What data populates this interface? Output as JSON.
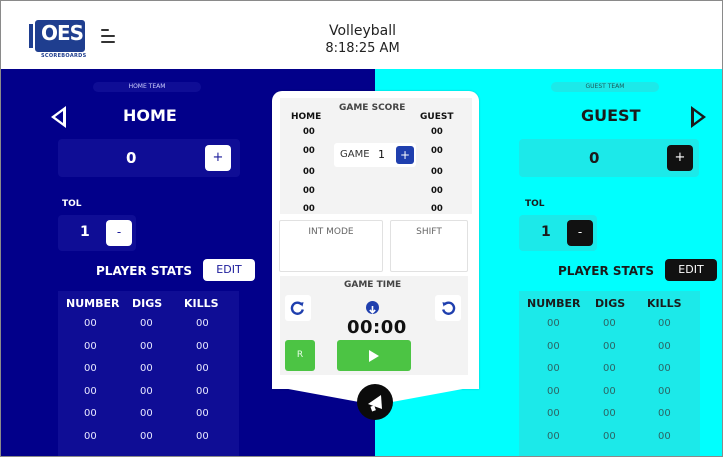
{
  "header": {
    "logo_text": "OES",
    "logo_sub": "SCOREBOARDS",
    "title": "Volleyball",
    "clock": "8:18:25 AM"
  },
  "home": {
    "pill": "HOME TEAM",
    "name": "HOME",
    "score": "0",
    "plus": "+",
    "tol_label": "TOL",
    "tol_value": "1",
    "minus": "-",
    "player_stats": "PLAYER STATS",
    "edit": "EDIT",
    "stats_headers": [
      "NUMBER",
      "DIGS",
      "KILLS"
    ],
    "stats_rows": [
      [
        "00",
        "00",
        "00"
      ],
      [
        "00",
        "00",
        "00"
      ],
      [
        "00",
        "00",
        "00"
      ],
      [
        "00",
        "00",
        "00"
      ],
      [
        "00",
        "00",
        "00"
      ],
      [
        "00",
        "00",
        "00"
      ]
    ]
  },
  "guest": {
    "pill": "GUEST TEAM",
    "name": "GUEST",
    "score": "0",
    "plus": "+",
    "tol_label": "TOL",
    "tol_value": "1",
    "minus": "-",
    "player_stats": "PLAYER STATS",
    "edit": "EDIT",
    "stats_headers": [
      "NUMBER",
      "DIGS",
      "KILLS"
    ],
    "stats_rows": [
      [
        "00",
        "00",
        "00"
      ],
      [
        "00",
        "00",
        "00"
      ],
      [
        "00",
        "00",
        "00"
      ],
      [
        "00",
        "00",
        "00"
      ],
      [
        "00",
        "00",
        "00"
      ],
      [
        "00",
        "00",
        "00"
      ]
    ]
  },
  "center": {
    "game_score_title": "GAME SCORE",
    "home_label": "HOME",
    "guest_label": "GUEST",
    "home_games": [
      "00",
      "00",
      "00",
      "00",
      "00"
    ],
    "guest_games": [
      "00",
      "00",
      "00",
      "00",
      "00"
    ],
    "game_label": "GAME",
    "game_number": "1",
    "game_plus": "+",
    "int_mode": "INT MODE",
    "shift": "SHIFT",
    "game_time_title": "GAME TIME",
    "time": "00:00",
    "r_label": "R"
  },
  "colors": {
    "home_bg": "#02008a",
    "guest_bg": "#00fffe",
    "accent_blue": "#1f3fae",
    "play_green": "#4cc444"
  },
  "icons": {
    "menu": "hamburger-icon",
    "home_arrow": "triangle-left-icon",
    "guest_arrow": "triangle-right-icon",
    "redo": "redo-icon",
    "undo": "undo-icon",
    "down": "arrow-down-circle-icon",
    "play": "play-icon",
    "horn": "horn-icon"
  }
}
